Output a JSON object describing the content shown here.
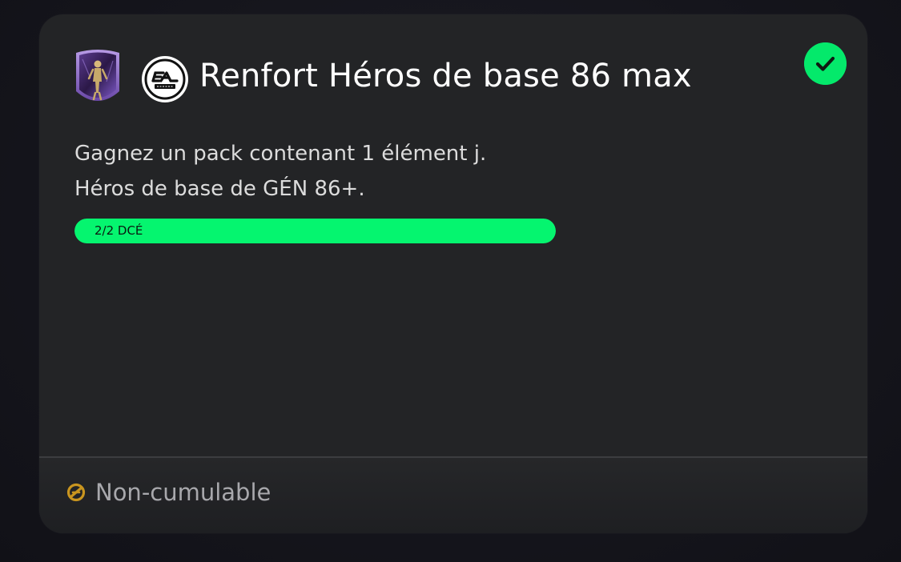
{
  "objective": {
    "title": "Renfort Héros de base 86 max",
    "description_lines": [
      "Gagnez un pack contenant 1 élément j.",
      "Héros de base de GÉN 86+."
    ],
    "progress": {
      "label": "2/2 DCÉ",
      "current": 2,
      "total": 2,
      "fraction": 1.0
    },
    "completed": true,
    "badge_icon": "hero-card-badge-icon",
    "brand_icon": "ea-sports-logo-icon",
    "status_icon": "checkmark-icon"
  },
  "footer": {
    "icon": "non-stackable-icon",
    "label": "Non-cumulable"
  },
  "colors": {
    "accent_green": "#05f56f",
    "card_background": "#232426",
    "footer_icon": "#c9951f"
  }
}
